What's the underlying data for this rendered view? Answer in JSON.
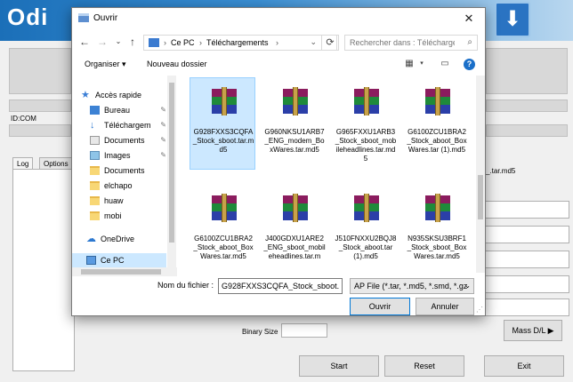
{
  "odin": {
    "logo": "Odi",
    "id_com_label": "ID:COM",
    "tabs": [
      "Log",
      "Options"
    ],
    "side_text": "_.tar.md5",
    "binary_size_label": "Binary Size",
    "mass_dl_label": "Mass D/L ▶",
    "start_label": "Start",
    "reset_label": "Reset",
    "exit_label": "Exit"
  },
  "dialog": {
    "title": "Ouvrir",
    "close_glyph": "✕",
    "address": {
      "segments": [
        "Ce PC",
        "Téléchargements"
      ]
    },
    "search_placeholder": "Rechercher dans : Télécharge...",
    "toolbar": {
      "organize": "Organiser ▾",
      "new_folder": "Nouveau dossier"
    },
    "nav_items": [
      {
        "label": "Accès rapide"
      },
      {
        "label": "Bureau"
      },
      {
        "label": "Téléchargem"
      },
      {
        "label": "Documents"
      },
      {
        "label": "Images"
      },
      {
        "label": "Documents"
      },
      {
        "label": "elchapo"
      },
      {
        "label": "huaw"
      },
      {
        "label": "mobi"
      },
      {
        "label": "OneDrive"
      },
      {
        "label": "Ce PC"
      }
    ],
    "files": [
      {
        "name": "G928FXXS3CQFA_Stock_sboot.tar.md5"
      },
      {
        "name": "G960NKSU1ARB7_ENG_modem_BoxWares.tar.md5"
      },
      {
        "name": "G965FXXU1ARB3_Stock_sboot_mobileheadlines.tar.md5"
      },
      {
        "name": "G6100ZCU1BRA2_Stock_aboot_BoxWares.tar (1).md5"
      },
      {
        "name": "G6100ZCU1BRA2_Stock_aboot_BoxWares.tar.md5"
      },
      {
        "name": "J400GDXU1ARE2_ENG_sboot_mobileheadlines.tar.m"
      },
      {
        "name": "J510FNXXU2BQJ8_Stock_aboot.tar (1).md5"
      },
      {
        "name": "N935SKSU3BRF1_Stock_sboot_BoxWares.tar.md5"
      }
    ],
    "filename_label": "Nom du fichier :",
    "filename_value": "G928FXXS3CQFA_Stock_sboot.t",
    "filetype_value": "AP File (*.tar, *.md5, *.smd, *.gz",
    "open_label": "Ouvrir",
    "cancel_label": "Annuler"
  }
}
